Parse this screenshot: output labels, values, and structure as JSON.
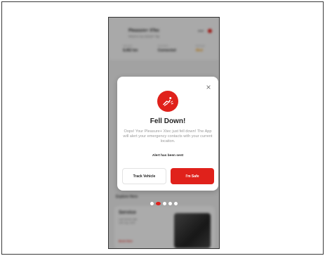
{
  "background": {
    "app_title": "Pleasure+ XTec",
    "subtitle": "Where's my vehicle? Tap",
    "stats": [
      {
        "label": "Odometer",
        "value": "8,452 km"
      },
      {
        "label": "Connection",
        "value": "Connected"
      },
      {
        "label": "Fuel level",
        "value": "Med"
      }
    ],
    "section_title": "Explore Hero",
    "card_title": "Service",
    "card_line1": "Last service date",
    "card_line2": "12th July, 2023",
    "card_link": "Book Now"
  },
  "modal": {
    "icon": "fall-down-icon",
    "title": "Fell Down!",
    "body": "Oops! Your Pleasure+ Xtec just fell down! The App will alert your emergency contacts with your current location.",
    "alert_text": "Alert has been sent",
    "track_button": "Track Vehicle",
    "safe_button": "I'm Safe",
    "close_icon": "close-icon"
  },
  "carousel": {
    "count": 5,
    "active_index": 1
  },
  "colors": {
    "accent": "#e0211b",
    "overlay": "rgba(0,0,0,0.30)"
  }
}
